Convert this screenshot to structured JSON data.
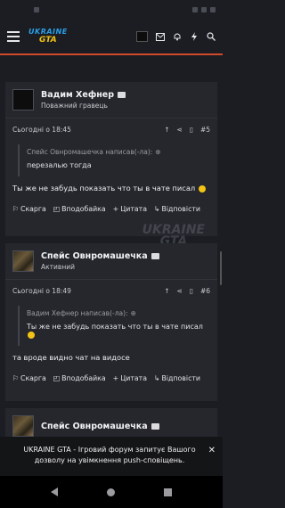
{
  "header": {
    "logo_line1": "UKRAINE",
    "logo_line2": "GTA"
  },
  "posts": [
    {
      "username": "Вадим Хефнер",
      "rank": "Поважний гравець",
      "time": "Сьогодні о 18:45",
      "number": "#5",
      "quote_author": "Спейс Овнромашечка написав(-ла):",
      "quote_text": "перезалью тогда",
      "message": "Ты же не забудь показать что ты в чате писал"
    },
    {
      "username": "Спейс Овнромашечка",
      "rank": "Активний",
      "time": "Сьогодні о 18:49",
      "number": "#6",
      "quote_author": "Вадим Хефнер написав(-ла):",
      "quote_text": "Ты же не забудь показать что ты в чате писал",
      "message": "та вроде видно чат на видосе"
    },
    {
      "username": "Спейс Овнромашечка"
    }
  ],
  "actions": {
    "report": "Скарга",
    "like": "Вподобайка",
    "quote": "Цитата",
    "reply": "Відповісти"
  },
  "toast": {
    "text": "UKRAINE GTA - Ігровий форум запитує Вашого дозволу на увімкнення push-сповіщень."
  },
  "icons": [
    "menu-icon",
    "envelope-icon",
    "bell-icon",
    "bolt-icon",
    "search-icon",
    "arrow-up-icon",
    "share-icon",
    "bookmark-icon",
    "flag-icon",
    "like-icon",
    "plus-icon",
    "reply-icon",
    "close-icon",
    "back-icon",
    "home-icon",
    "recent-apps-icon"
  ]
}
